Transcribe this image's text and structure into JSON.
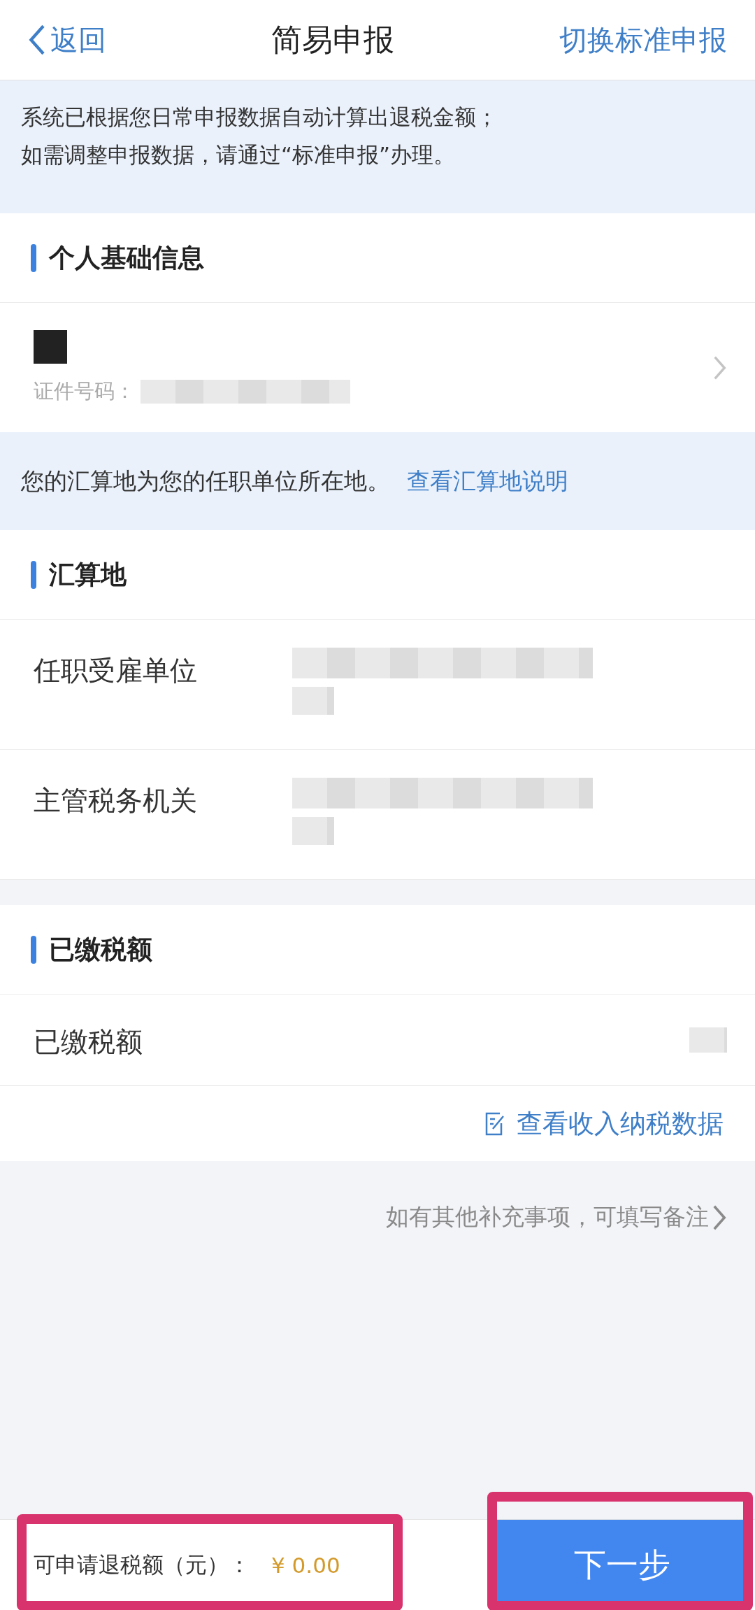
{
  "header": {
    "back": "返回",
    "title": "简易申报",
    "switch_link": "切换标准申报"
  },
  "notice": [
    "系统已根据您日常申报数据自动计算出退税金额；",
    "如需调整申报数据，请通过“标准申报”办理。"
  ],
  "personal": {
    "heading": "个人基础信息",
    "id_label": "证件号码："
  },
  "location_notice": {
    "text": "您的汇算地为您的任职单位所在地。",
    "link": "查看汇算地说明"
  },
  "location": {
    "heading": "汇算地",
    "rows": [
      {
        "label": "任职受雇单位"
      },
      {
        "label": "主管税务机关"
      }
    ]
  },
  "paid": {
    "heading": "已缴税额",
    "rows": [
      {
        "label": "已缴税额"
      }
    ]
  },
  "income_link": "查看收入纳税数据",
  "remark_link": "如有其他补充事项，可填写备注",
  "footer": {
    "refund_label": "可申请退税额（元）：",
    "amount": "¥ 0.00",
    "next_button": "下一步"
  }
}
